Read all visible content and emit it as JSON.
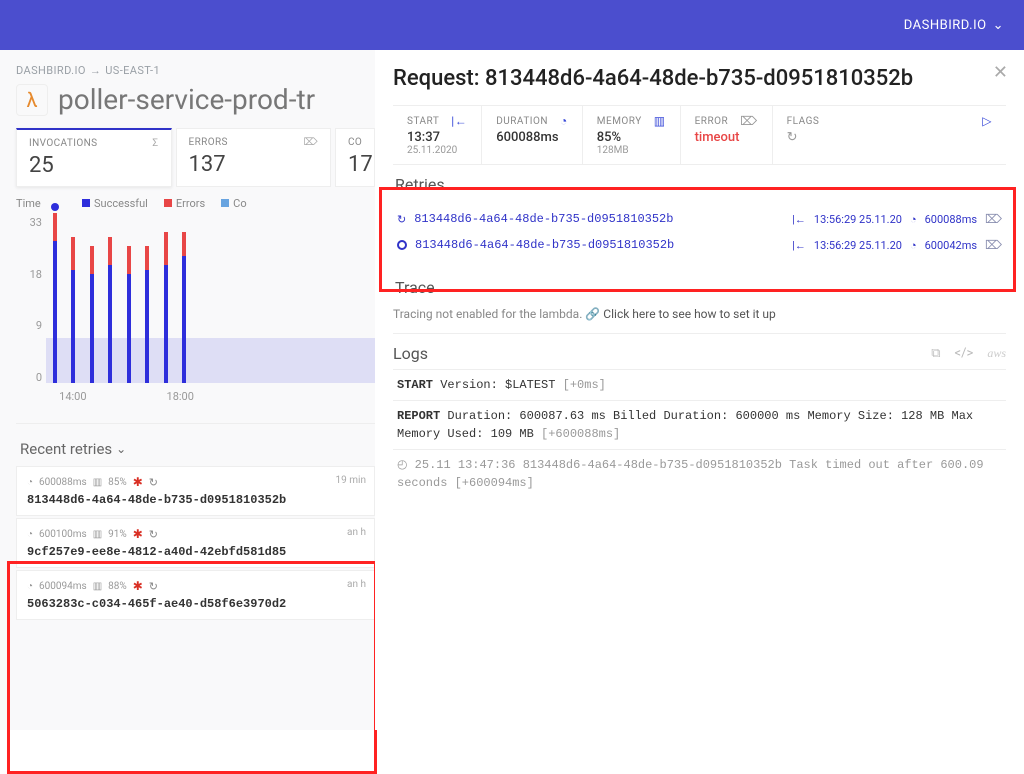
{
  "topbar": {
    "label": "DASHBIRD.IO"
  },
  "breadcrumb": {
    "org": "DASHBIRD.IO",
    "region": "US-EAST-1"
  },
  "function": {
    "title": "poller-service-prod-tr"
  },
  "stats": {
    "invocations": {
      "label": "INVOCATIONS",
      "value": "25"
    },
    "errors": {
      "label": "ERRORS",
      "value": "137"
    },
    "cold": {
      "label": "CO",
      "value": "17"
    }
  },
  "legend": {
    "time": "Time",
    "successful": "Successful",
    "errors": "Errors",
    "coldstarts": "Co"
  },
  "chart_data": {
    "type": "bar",
    "y_ticks": [
      33,
      18,
      9,
      0
    ],
    "x_labels": [
      "14:00",
      "18:00"
    ],
    "series": [
      {
        "name": "Successful",
        "color": "#2e2edb"
      },
      {
        "name": "Errors",
        "color": "#e84646"
      }
    ],
    "bars": [
      {
        "succ": 30,
        "err": 6,
        "dot": true
      },
      {
        "succ": 24,
        "err": 7
      },
      {
        "succ": 23,
        "err": 6
      },
      {
        "succ": 25,
        "err": 6
      },
      {
        "succ": 23,
        "err": 6
      },
      {
        "succ": 24,
        "err": 5
      },
      {
        "succ": 25,
        "err": 7
      },
      {
        "succ": 27,
        "err": 5
      }
    ],
    "ylim": [
      0,
      36
    ]
  },
  "recent_retries": {
    "title": "Recent retries",
    "items": [
      {
        "dur": "600088ms",
        "mem": "85%",
        "age": "19 min",
        "id": "813448d6-4a64-48de-b735-d0951810352b"
      },
      {
        "dur": "600100ms",
        "mem": "91%",
        "age": "an h",
        "id": "9cf257e9-ee8e-4812-a40d-42ebfd581d85"
      },
      {
        "dur": "600094ms",
        "mem": "88%",
        "age": "an h",
        "id": "5063283c-c034-465f-ae40-d58f6e3970d2"
      }
    ]
  },
  "request": {
    "title_prefix": "Request: ",
    "id": "813448d6-4a64-48de-b735-d0951810352b"
  },
  "info": {
    "start": {
      "label": "START",
      "v1": "13:37",
      "v2": "25.11.2020"
    },
    "duration": {
      "label": "DURATION",
      "v1": "600088ms"
    },
    "memory": {
      "label": "MEMORY",
      "v1": "85%",
      "v2": "128MB"
    },
    "error": {
      "label": "ERROR",
      "v1": "timeout"
    },
    "flags": {
      "label": "FLAGS"
    }
  },
  "retries_panel": {
    "title": "Retries",
    "rows": [
      {
        "id": "813448d6-4a64-48de-b735-d0951810352b",
        "ts": "13:56:29 25.11.20",
        "dur": "600088ms",
        "icon": "reload"
      },
      {
        "id": "813448d6-4a64-48de-b735-d0951810352b",
        "ts": "13:56:29 25.11.20",
        "dur": "600042ms",
        "icon": "circle"
      }
    ]
  },
  "trace": {
    "title": "Trace",
    "msg": "Tracing not enabled for the lambda. ",
    "link": "Click here to see how to set it up"
  },
  "logs": {
    "title": "Logs",
    "lines": [
      {
        "html": "<span class='kw'>START</span>  Version: $LATEST <span class='br'>[+0ms]</span>"
      },
      {
        "html": "<span class='kw'>REPORT</span>  Duration: 600087.63 ms  Billed Duration: 600000 ms    Memory Size: 128 MB  Max Memory Used: 109 MB  <span class='br'>[+600088ms]</span>"
      },
      {
        "muted": true,
        "html": "&#9716; 25.11 13:47:36 813448d6-4a64-48de-b735-d0951810352b Task timed out after 600.09 seconds <span class='br'>[+600094ms]</span>"
      }
    ]
  }
}
